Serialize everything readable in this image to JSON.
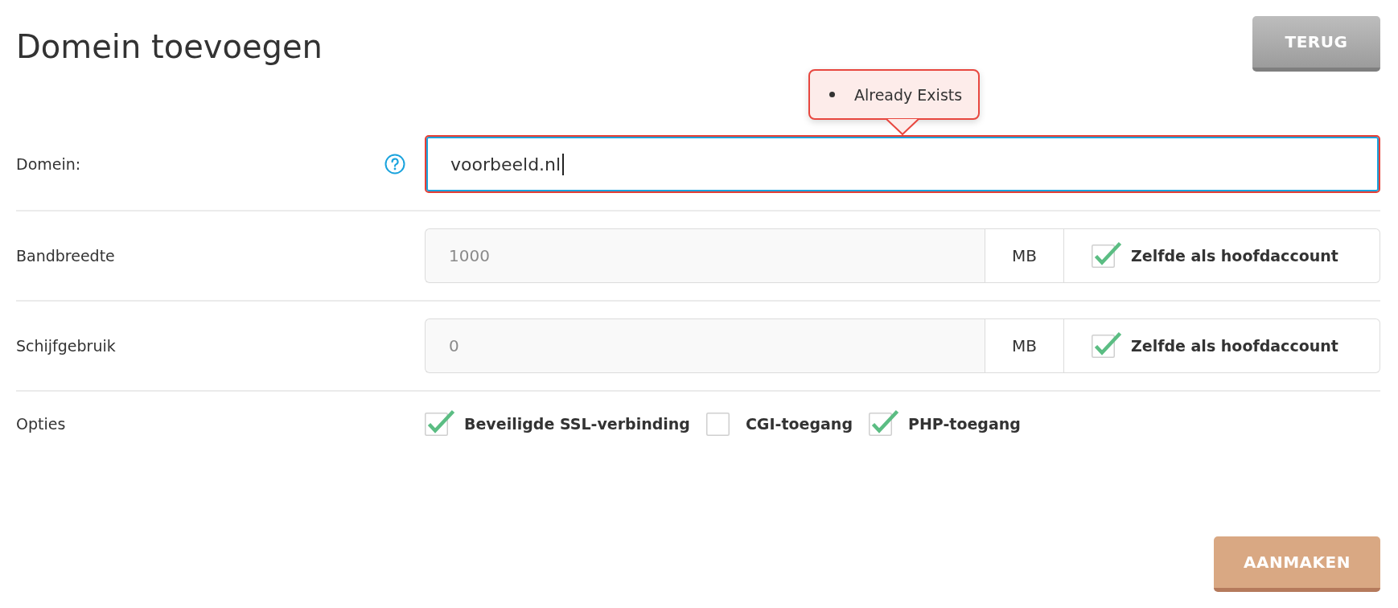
{
  "header": {
    "title": "Domein toevoegen",
    "back_button": "TERUG"
  },
  "rows": [
    {
      "kind": "text",
      "label": "Domein:",
      "help": true,
      "value": "voorbeeld.nl",
      "focused": true,
      "error": {
        "messages": [
          "Already Exists"
        ]
      }
    },
    {
      "kind": "quota",
      "label": "Bandbreedte",
      "value": "1000",
      "disabled": true,
      "unit": "MB",
      "same_as_main": {
        "label": "Zelfde als hoofdaccount",
        "checked": true
      }
    },
    {
      "kind": "quota",
      "label": "Schijfgebruik",
      "value": "0",
      "disabled": true,
      "unit": "MB",
      "same_as_main": {
        "label": "Zelfde als hoofdaccount",
        "checked": true
      }
    },
    {
      "kind": "options",
      "label": "Opties",
      "items": [
        {
          "label": "Beveiligde SSL-verbinding",
          "checked": true
        },
        {
          "label": "CGI-toegang",
          "checked": false
        },
        {
          "label": "PHP-toegang",
          "checked": true
        }
      ]
    }
  ],
  "submit_button": "AANMAKEN"
}
